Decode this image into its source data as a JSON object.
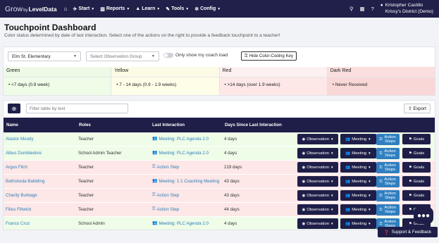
{
  "nav": {
    "brand_part1": "Grow",
    "brand_part2": "by",
    "brand_part3": "LevelData",
    "home_icon": "home-icon",
    "menus": [
      {
        "label": "Start",
        "icon": "rocket-icon"
      },
      {
        "label": "Reports",
        "icon": "bar-chart-icon"
      },
      {
        "label": "Learn",
        "icon": "graduation-cap-icon"
      },
      {
        "label": "Tools",
        "icon": "wrench-icon"
      },
      {
        "label": "Config",
        "icon": "gear-icon"
      }
    ],
    "user_name": "Kristopher Castillo",
    "user_district": "Krissy's District (Demo)"
  },
  "page": {
    "title": "Touchpoint Dashboard",
    "subtitle": "Color status determined by date of last interaction. Select one of the actions on the right to provide a feedback touchpoint to a teacher!"
  },
  "filters": {
    "school": "Elm St. Elementary",
    "observation_group_placeholder": "Select Observation Group",
    "coach_toggle_label": "Only show my coach load",
    "hide_key_label": "Hide Color-Coding Key"
  },
  "legend": [
    {
      "label": "Green",
      "desc": "<7 days (0.9 week)",
      "head_bg": "#eef9e6",
      "body_bg": "#eefce8"
    },
    {
      "label": "Yellow",
      "desc": "7 - 14 days (0.9 - 1.9 weeks)",
      "head_bg": "#fbfbe6",
      "body_bg": "#fefde8"
    },
    {
      "label": "Red",
      "desc": ">14 days (over 1.9 weeks)",
      "head_bg": "#fdf0f0",
      "body_bg": "#fde7e7"
    },
    {
      "label": "Dark Red",
      "desc": "Never Received",
      "head_bg": "#fbdede",
      "body_bg": "#f9d7d7"
    }
  ],
  "table": {
    "filter_placeholder": "Filter table by text",
    "export_label": "Export",
    "columns": [
      "Name",
      "Roles",
      "Last Interaction",
      "Days Since Last Interaction"
    ],
    "actions": {
      "observation": "Observation",
      "meeting": "Meeting",
      "action_steps": "Action Steps",
      "goals": "Goals"
    },
    "rows": [
      {
        "name": "Alastor Moody",
        "role": "Teacher",
        "last": "Meeting: PLC Agenda 2.0",
        "last_icon": "users-icon",
        "days": "4 days",
        "bg": "#eefce8"
      },
      {
        "name": "Albus Dumbledore",
        "role": "School Admin Teacher",
        "last": "Meeting: PLC Agenda 2.0",
        "last_icon": "users-icon",
        "days": "4 days",
        "bg": "#eefce8"
      },
      {
        "name": "Argus Filch",
        "role": "Teacher",
        "last": "Action Step",
        "last_icon": "key-icon",
        "days": "219 days",
        "bg": "#fde7e7"
      },
      {
        "name": "Bathsheda Babbling",
        "role": "Teacher",
        "last": "Meeting: 1:1 Coaching Meeting",
        "last_icon": "users-icon",
        "days": "43 days",
        "bg": "#fde7e7"
      },
      {
        "name": "Charity Burbage",
        "role": "Teacher",
        "last": "Action Step",
        "last_icon": "key-icon",
        "days": "43 days",
        "bg": "#fde7e7"
      },
      {
        "name": "Filius Flitwick",
        "role": "Teacher",
        "last": "Action Step",
        "last_icon": "key-icon",
        "days": "44 days",
        "bg": "#fde7e7"
      },
      {
        "name": "Franco Cruz",
        "role": "School Admin",
        "last": "Meeting: PLC Agenda 2.0",
        "last_icon": "users-icon",
        "days": "4 days",
        "bg": "#eefce8"
      }
    ]
  },
  "support": {
    "label": "Support & Feedback",
    "icon": "question-circle-icon",
    "chat_icon": "chat-bubble-icon"
  }
}
